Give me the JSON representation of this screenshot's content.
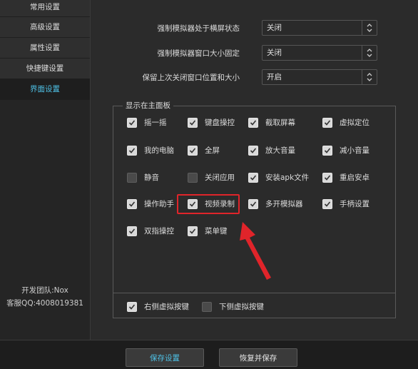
{
  "sidebar": {
    "items": [
      {
        "label": "常用设置"
      },
      {
        "label": "高级设置"
      },
      {
        "label": "属性设置"
      },
      {
        "label": "快捷键设置"
      },
      {
        "label": "界面设置",
        "active": true
      }
    ],
    "team": "开发团队:Nox",
    "support": "客服QQ:4008019381"
  },
  "settings": [
    {
      "label": "强制模拟器处于横屏状态",
      "value": "关闭"
    },
    {
      "label": "强制模拟器窗口大小固定",
      "value": "关闭"
    },
    {
      "label": "保留上次关闭窗口位置和大小",
      "value": "开启"
    }
  ],
  "panel": {
    "title": "显示在主面板",
    "checkboxes": [
      {
        "label": "摇一摇",
        "checked": true
      },
      {
        "label": "键盘操控",
        "checked": true
      },
      {
        "label": "截取屏幕",
        "checked": true
      },
      {
        "label": "虚拟定位",
        "checked": true
      },
      {
        "label": "我的电脑",
        "checked": true
      },
      {
        "label": "全屏",
        "checked": true
      },
      {
        "label": "放大音量",
        "checked": true
      },
      {
        "label": "减小音量",
        "checked": true
      },
      {
        "label": "静音",
        "checked": false
      },
      {
        "label": "关闭应用",
        "checked": false
      },
      {
        "label": "安装apk文件",
        "checked": true
      },
      {
        "label": "重启安卓",
        "checked": true
      },
      {
        "label": "操作助手",
        "checked": true
      },
      {
        "label": "视频录制",
        "checked": true
      },
      {
        "label": "多开模拟器",
        "checked": true
      },
      {
        "label": "手柄设置",
        "checked": true
      },
      {
        "label": "双指操控",
        "checked": true
      },
      {
        "label": "菜单键",
        "checked": true
      }
    ],
    "bottom": [
      {
        "label": "右侧虚拟按键",
        "checked": true
      },
      {
        "label": "下侧虚拟按键",
        "checked": false
      }
    ]
  },
  "footer": {
    "save": "保存设置",
    "restore": "恢复并保存"
  },
  "colors": {
    "accent": "#4fc3e8",
    "highlight": "#e0242a"
  }
}
